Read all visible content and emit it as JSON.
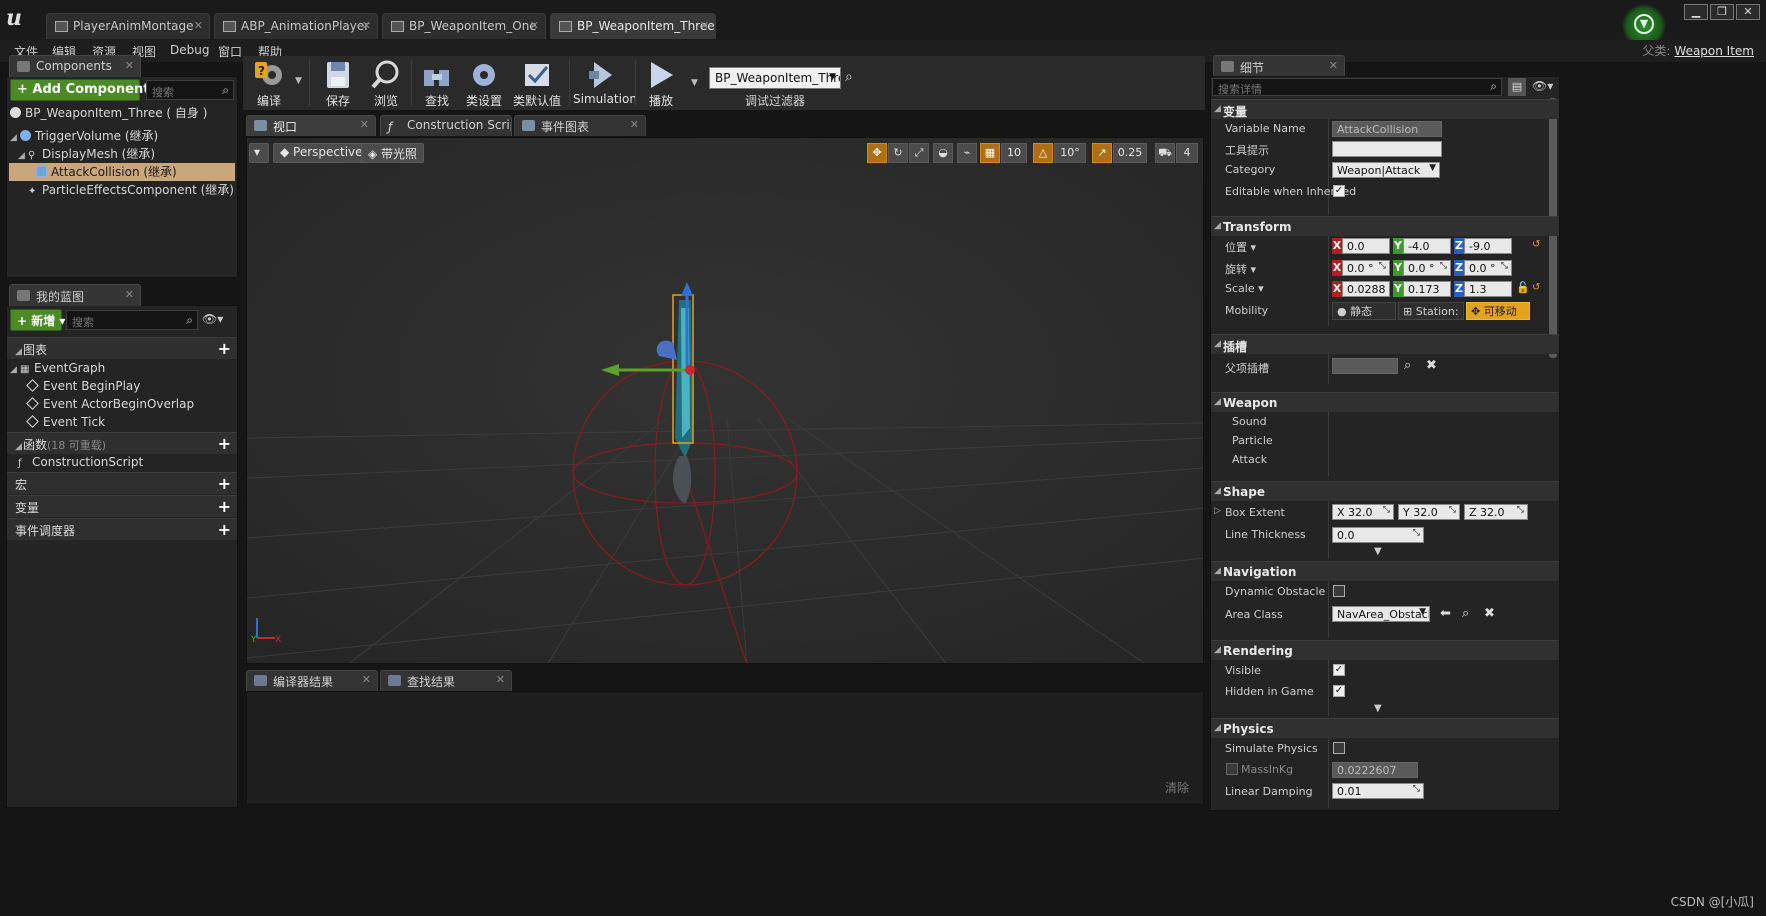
{
  "title_bar": {
    "tabs": [
      {
        "label": "PlayerAnimMontage",
        "active": false
      },
      {
        "label": "ABP_AnimationPlayer",
        "active": false
      },
      {
        "label": "BP_WeaponItem_One",
        "active": false
      },
      {
        "label": "BP_WeaponItem_Three*",
        "active": true
      }
    ],
    "window_controls": {
      "minimize": "▁",
      "restore": "❐",
      "close": "✕"
    }
  },
  "menu": {
    "items": [
      "文件",
      "编辑",
      "资源",
      "视图",
      "Debug",
      "窗口",
      "帮助"
    ],
    "parent_class_label": "父类:",
    "parent_class_value": "Weapon Item"
  },
  "components_panel": {
    "tab_label": "Components",
    "add_button": "+ Add Component",
    "search_placeholder": "搜索",
    "tree": [
      {
        "label": "BP_WeaponItem_Three ( 自身 )",
        "indent": 0,
        "icon": "root-dot-icon",
        "selected": false
      },
      {
        "label": "TriggerVolume (继承)",
        "indent": 1,
        "icon": "sphere-icon",
        "selected": false
      },
      {
        "label": "DisplayMesh (继承)",
        "indent": 2,
        "icon": "mesh-icon",
        "selected": false
      },
      {
        "label": "AttackCollision (继承)",
        "indent": 3,
        "icon": "box-icon",
        "selected": true
      },
      {
        "label": "ParticleEffectsComponent (继承)",
        "indent": 2,
        "icon": "particle-icon",
        "selected": false
      }
    ]
  },
  "my_blueprint": {
    "tab_label": "我的蓝图",
    "new_button": "新增",
    "search_placeholder": "搜索",
    "graphs_header": "图表",
    "event_graph": "EventGraph",
    "events": [
      "Event BeginPlay",
      "Event ActorBeginOverlap",
      "Event Tick"
    ],
    "functions_header": "函数",
    "functions_sub": "(18 可重载)",
    "construction_script": "ConstructionScript",
    "macros_header": "宏",
    "variables_header": "变量",
    "dispatchers_header": "事件调度器"
  },
  "toolbar": {
    "buttons": [
      {
        "label": "编译",
        "icon": "compile-icon"
      },
      {
        "label": "保存",
        "icon": "save-icon"
      },
      {
        "label": "浏览",
        "icon": "browse-icon"
      },
      {
        "label": "查找",
        "icon": "find-icon"
      },
      {
        "label": "类设置",
        "icon": "class-settings-icon"
      },
      {
        "label": "类默认值",
        "icon": "class-defaults-icon"
      },
      {
        "label": "Simulation",
        "icon": "simulation-icon"
      },
      {
        "label": "播放",
        "icon": "play-icon"
      }
    ],
    "debug_object": "BP_WeaponItem_Three",
    "debug_filter_label": "调试过滤器"
  },
  "editor_tabs": [
    "视口",
    "Construction Scrip",
    "事件图表"
  ],
  "viewport": {
    "perspective_label": "Perspective",
    "lit_label": "带光照",
    "grid_snap": "10",
    "rotation_snap": "10°",
    "scale_snap": "0.25",
    "camera_speed": "4"
  },
  "bottom_tabs": [
    "编译器结果",
    "查找结果"
  ],
  "bottom_clear": "清除",
  "details": {
    "tab_label": "细节",
    "search_placeholder": "搜索详情",
    "cat_variable": "变量",
    "variable_name_label": "Variable Name",
    "variable_name_value": "AttackCollision",
    "tooltip_label": "工具提示",
    "category_label": "Category",
    "category_value": "Weapon|Attack",
    "editable_inherited_label": "Editable when Inherited",
    "cat_transform": "Transform",
    "location_label": "位置",
    "location": {
      "x": "0.0",
      "y": "-4.0",
      "z": "-9.0"
    },
    "rotation_label": "旋转",
    "rotation": {
      "x": "0.0 °",
      "y": "0.0 °",
      "z": "0.0 °"
    },
    "scale_label": "Scale",
    "scale": {
      "x": "0.0288",
      "y": "0.173",
      "z": "1.3"
    },
    "mobility_label": "Mobility",
    "mobility_static": "静态",
    "mobility_stationary": "Station:",
    "mobility_movable": "可移动",
    "cat_socket": "插槽",
    "parent_socket_label": "父项插槽",
    "cat_weapon": "Weapon",
    "weapon_items": [
      "Sound",
      "Particle",
      "Attack"
    ],
    "cat_shape": "Shape",
    "box_extent_label": "Box Extent",
    "box_extent": {
      "x": "32.0",
      "y": "32.0",
      "z": "32.0"
    },
    "line_thickness_label": "Line Thickness",
    "line_thickness_value": "0.0",
    "cat_navigation": "Navigation",
    "dynamic_obstacle_label": "Dynamic Obstacle",
    "area_class_label": "Area Class",
    "area_class_value": "NavArea_Obstacle",
    "cat_rendering": "Rendering",
    "visible_label": "Visible",
    "hidden_in_game_label": "Hidden in Game",
    "cat_physics": "Physics",
    "simulate_physics_label": "Simulate Physics",
    "mass_label": "MassInKg",
    "mass_value": "0.0222607",
    "linear_damping_label": "Linear Damping",
    "linear_damping_value": "0.01"
  },
  "watermark": "CSDN @[小瓜]"
}
